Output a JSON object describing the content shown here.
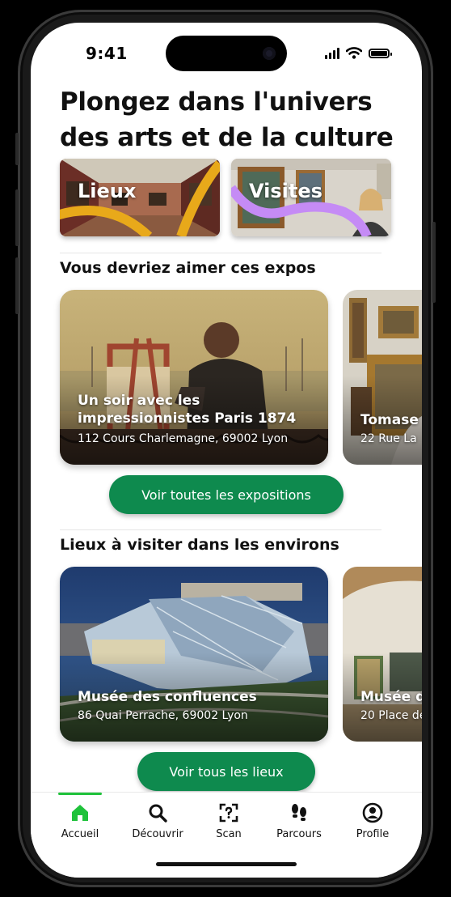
{
  "status_bar": {
    "time": "9:41"
  },
  "headline": "Plongez dans l'univers des arts et de la culture",
  "categories": [
    {
      "label": "Lieux"
    },
    {
      "label": "Visites"
    }
  ],
  "section_expos": {
    "title": "Vous devriez aimer ces expos",
    "cards": [
      {
        "title": "Un soir avec les impressionnistes Paris 1874",
        "address": "112 Cours Charlemagne, 69002 Lyon"
      },
      {
        "title": "Tomase",
        "address": "22 Rue La"
      }
    ],
    "cta_label": "Voir toutes les expositions"
  },
  "section_places": {
    "title": "Lieux à visiter dans les environs",
    "cards": [
      {
        "title": "Musée des confluences",
        "address": "86 Quai Perrache, 69002 Lyon"
      },
      {
        "title": "Musée d",
        "address": "20 Place de"
      }
    ],
    "cta_label": "Voir tous les lieux"
  },
  "tabbar": {
    "active": "Accueil",
    "accent_color": "#1fc23b",
    "items": [
      {
        "label": "Accueil",
        "icon": "home-icon"
      },
      {
        "label": "Découvrir",
        "icon": "search-icon"
      },
      {
        "label": "Scan",
        "icon": "scan-icon"
      },
      {
        "label": "Parcours",
        "icon": "footsteps-icon"
      },
      {
        "label": "Profile",
        "icon": "profile-icon"
      }
    ]
  },
  "colors": {
    "primary_button": "#0e8a4e",
    "accent_yellow": "#e8a91a",
    "accent_purple": "#c58bf5"
  }
}
